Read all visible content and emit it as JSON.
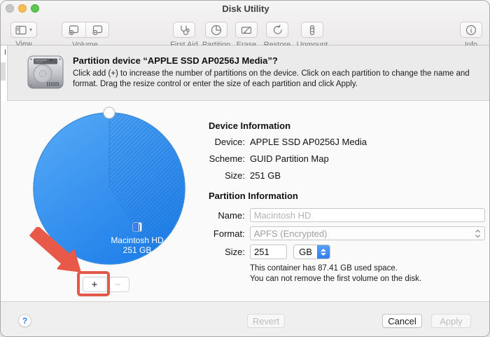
{
  "window": {
    "title": "Disk Utility"
  },
  "toolbar": {
    "view": {
      "label": "View"
    },
    "volume": {
      "label": "Volume"
    },
    "items": [
      {
        "label": "First Aid"
      },
      {
        "label": "Partition"
      },
      {
        "label": "Erase"
      },
      {
        "label": "Restore"
      },
      {
        "label": "Unmount"
      }
    ],
    "info": {
      "label": "Info"
    }
  },
  "sheet": {
    "sidebar_clip": "I",
    "title": "Partition device “APPLE SSD AP0256J Media”?",
    "description": "Click add (+) to increase the number of partitions on the device. Click on each partition to change the name and format. Drag the resize control or enter the size of each partition and click Apply."
  },
  "pie": {
    "volume_name": "Macintosh HD",
    "volume_size": "251 GB",
    "used_space_gb": 87.41,
    "total_space_gb": 251,
    "add_label": "+",
    "remove_label": "−"
  },
  "device_info": {
    "heading": "Device Information",
    "rows": [
      {
        "label": "Device:",
        "value": "APPLE SSD AP0256J Media"
      },
      {
        "label": "Scheme:",
        "value": "GUID Partition Map"
      },
      {
        "label": "Size:",
        "value": "251 GB"
      }
    ]
  },
  "partition_info": {
    "heading": "Partition Information",
    "name_label": "Name:",
    "name_placeholder": "Macintosh HD",
    "format_label": "Format:",
    "format_value": "APFS (Encrypted)",
    "size_label": "Size:",
    "size_value": "251",
    "unit_value": "GB",
    "note_line1": "This container has 87.41 GB used space.",
    "note_line2": "You can not remove the first volume on the disk."
  },
  "footer": {
    "help_label": "?",
    "revert_label": "Revert",
    "cancel_label": "Cancel",
    "apply_label": "Apply"
  },
  "colors": {
    "pie_blue_light": "#55aaf5",
    "pie_blue_dark": "#1f7fe9",
    "annotation_red": "#e2594b",
    "stepper_blue": "#3f87f5"
  }
}
